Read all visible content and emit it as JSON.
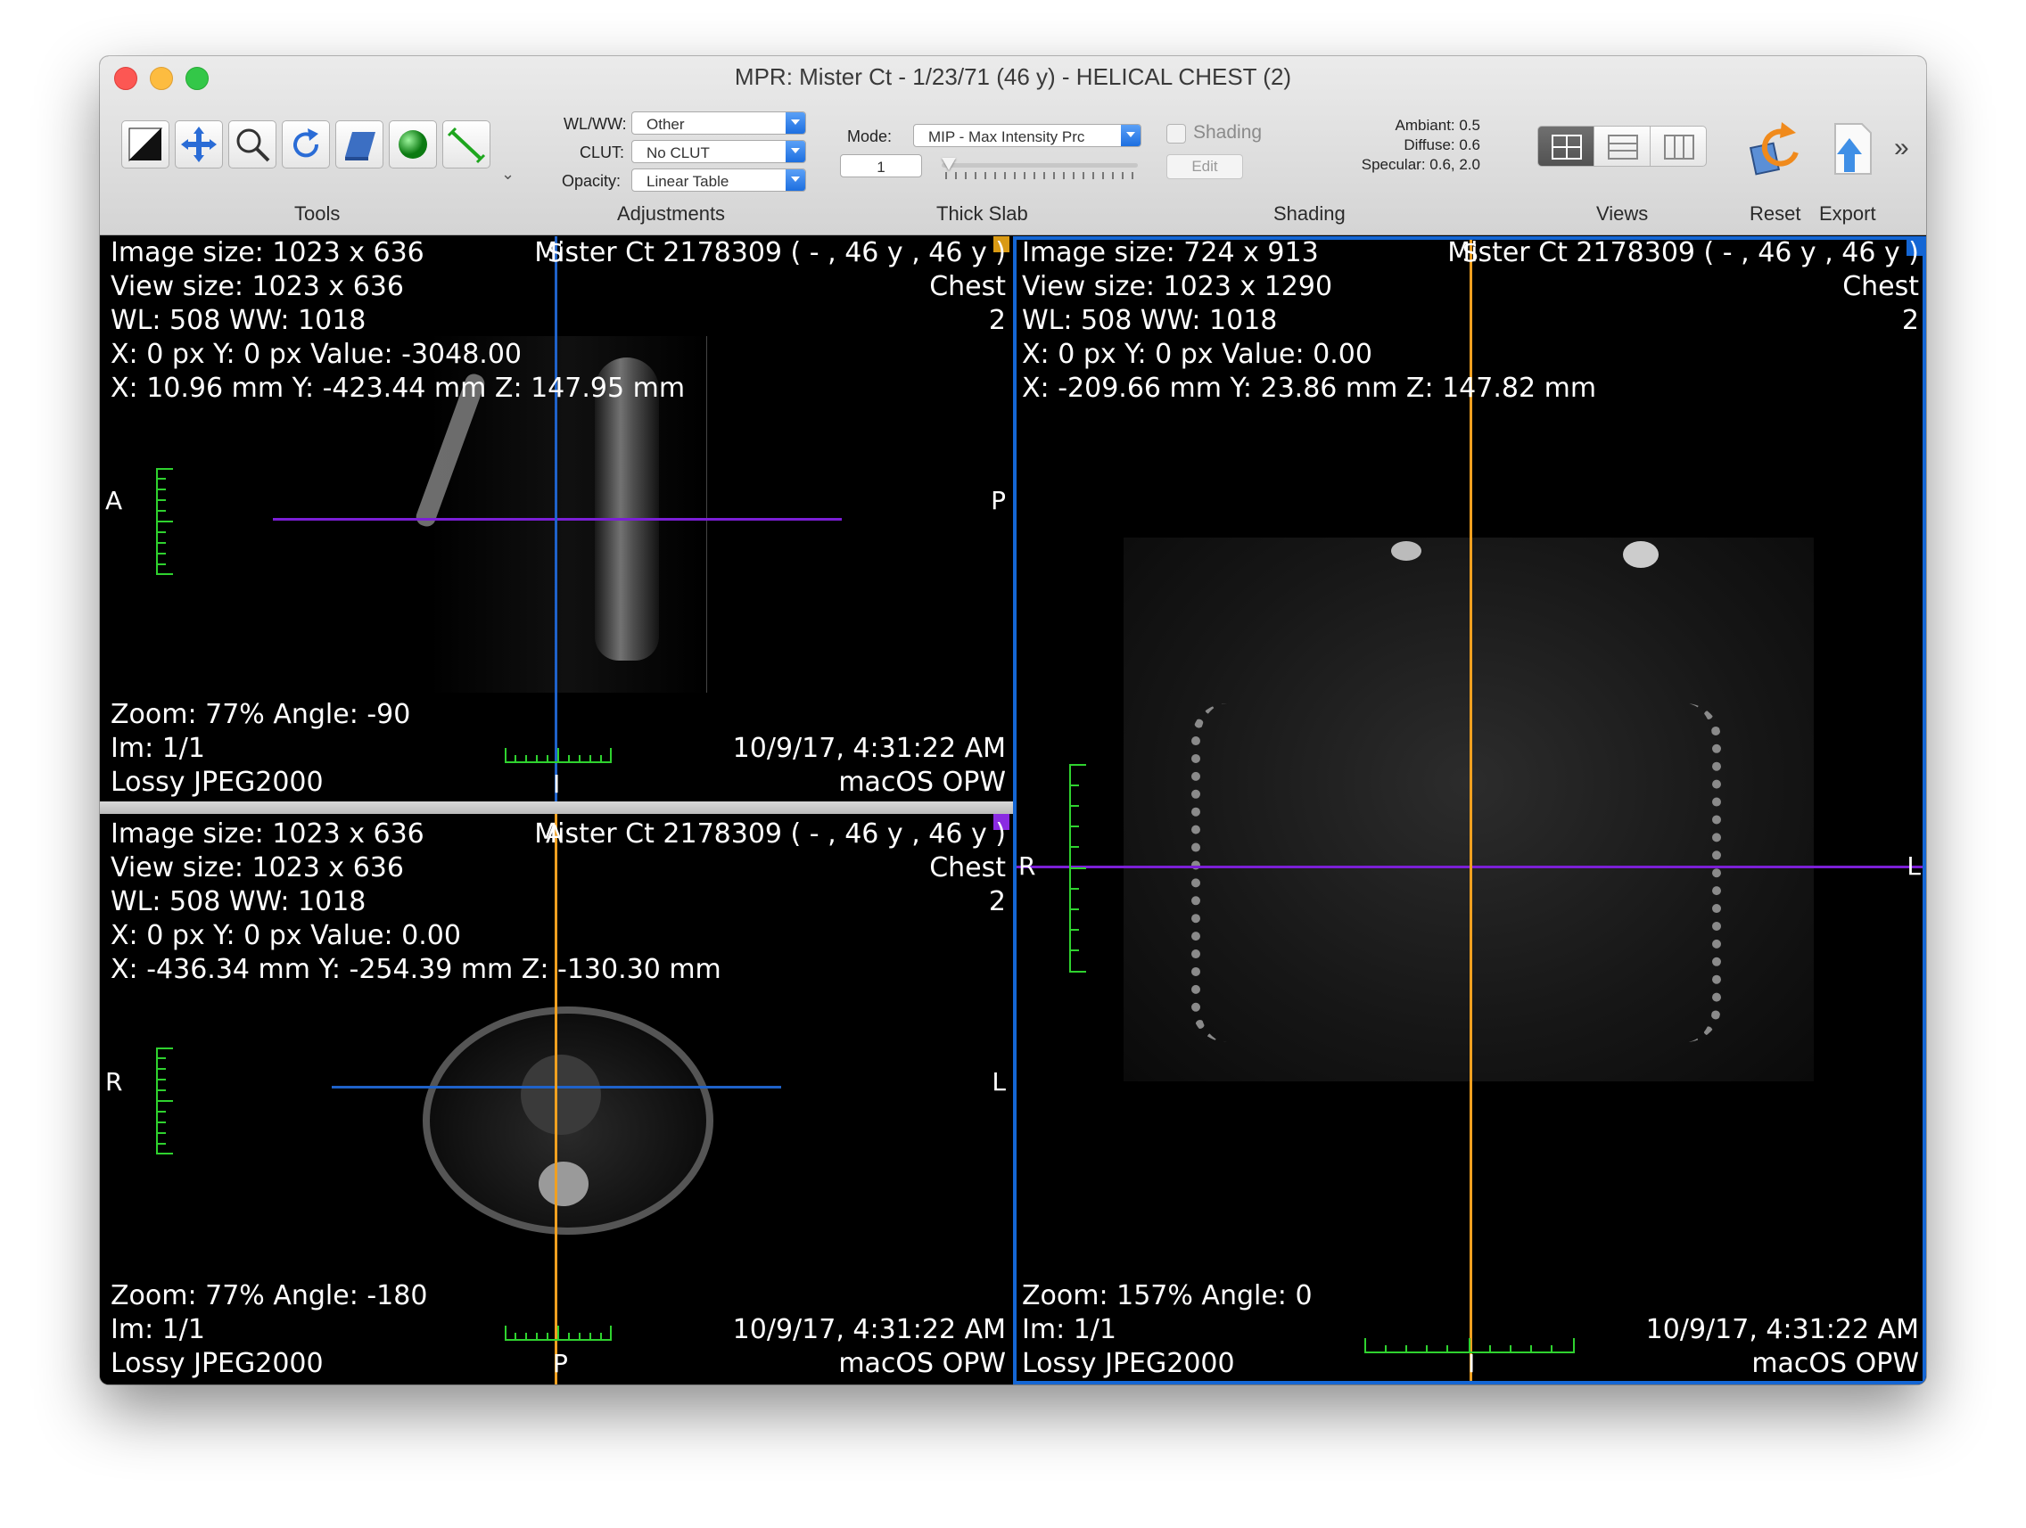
{
  "window": {
    "title": "MPR: Mister Ct - 1/23/71 (46 y) - HELICAL CHEST (2)"
  },
  "toolbar": {
    "tools_label": "Tools",
    "adjustments": {
      "label": "Adjustments",
      "wlww_label": "WL/WW:",
      "wlww_value": "Other",
      "clut_label": "CLUT:",
      "clut_value": "No CLUT",
      "opacity_label": "Opacity:",
      "opacity_value": "Linear Table"
    },
    "thick_slab": {
      "label": "Thick Slab",
      "mode_label": "Mode:",
      "mode_value": "MIP - Max Intensity Prc",
      "value": "1"
    },
    "shading": {
      "label": "Shading",
      "checkbox_label": "Shading",
      "edit_label": "Edit",
      "ambiant": "Ambiant: 0.5",
      "diffuse": "Diffuse: 0.6",
      "specular": "Specular: 0.6, 2.0"
    },
    "views_label": "Views",
    "reset_label": "Reset",
    "export_label": "Export"
  },
  "panels": {
    "sagittal": {
      "image_size": "Image size: 1023 x 636",
      "view_size": "View size: 1023 x 636",
      "wl": "WL: 508 WW: 1018",
      "px": "X: 0 px Y: 0 px Value: -3048.00",
      "mm": "X: 10.96 mm Y: -423.44 mm Z: 147.95 mm",
      "patient": "Mister Ct 2178309 (  - ,  46 y ,  46 y )",
      "study": "Chest",
      "series": "2",
      "zoom": "Zoom: 77% Angle: -90",
      "im": "Im: 1/1",
      "compression": "Lossy JPEG2000",
      "date": "10/9/17, 4:31:22 AM",
      "station": "macOS OPW",
      "left": "A",
      "right": "P",
      "top": "S",
      "bottom": "I"
    },
    "axial": {
      "image_size": "Image size: 1023 x 636",
      "view_size": "View size: 1023 x 636",
      "wl": "WL: 508 WW: 1018",
      "px": "X: 0 px Y: 0 px Value: 0.00",
      "mm": "X: -436.34 mm Y: -254.39 mm Z: -130.30 mm",
      "patient": "Mister Ct 2178309 (  - ,  46 y ,  46 y )",
      "study": "Chest",
      "series": "2",
      "zoom": "Zoom: 77% Angle: -180",
      "im": "Im: 1/1",
      "compression": "Lossy JPEG2000",
      "date": "10/9/17, 4:31:22 AM",
      "station": "macOS OPW",
      "left": "R",
      "right": "L",
      "top": "A",
      "bottom": "P"
    },
    "coronal": {
      "image_size": "Image size: 724 x 913",
      "view_size": "View size: 1023 x 1290",
      "wl": "WL: 508 WW: 1018",
      "px": "X: 0 px Y: 0 px Value: 0.00",
      "mm": "X: -209.66 mm Y: 23.86 mm Z: 147.82 mm",
      "patient": "Mister Ct 2178309 (  - ,  46 y ,  46 y )",
      "study": "Chest",
      "series": "2",
      "zoom": "Zoom: 157% Angle: 0",
      "im": "Im: 1/1",
      "compression": "Lossy JPEG2000",
      "date": "10/9/17, 4:31:22 AM",
      "station": "macOS OPW",
      "left": "R",
      "right": "L",
      "top": "S",
      "bottom": "I"
    }
  },
  "colors": {
    "axial_line": "#7b1fd6",
    "coronal_line": "#1f62c9",
    "sagittal_line": "#f0a020",
    "ruler": "#2fd22f",
    "active_border": "#1466d4"
  }
}
